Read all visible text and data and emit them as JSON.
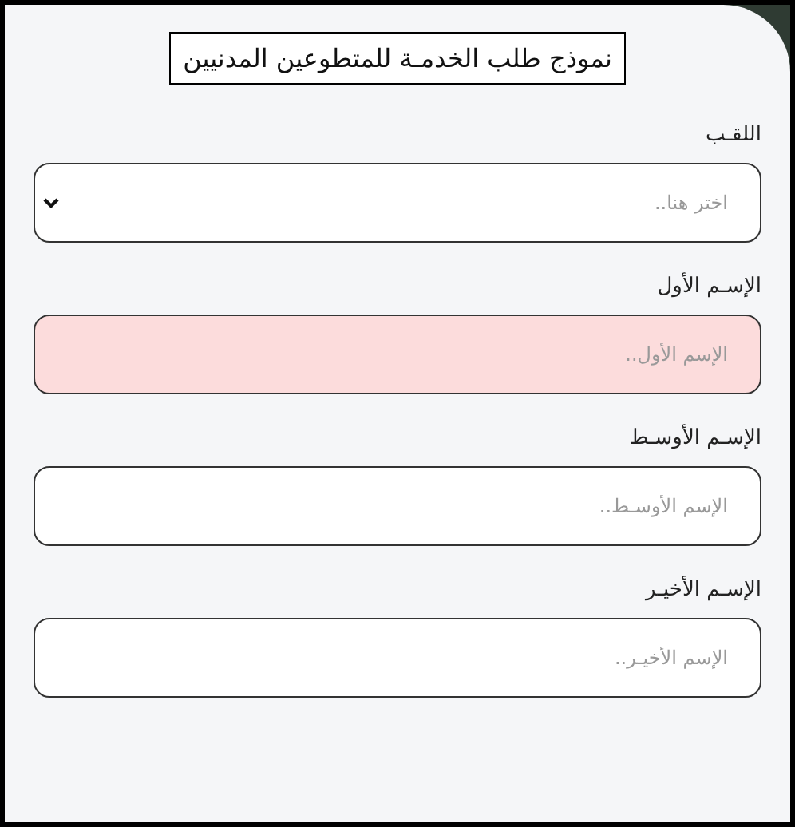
{
  "form": {
    "title": "نموذج طلب الخدمـة للمتطوعين المدنيين",
    "fields": [
      {
        "kind": "select",
        "label": "اللقـب",
        "placeholder": "اختر هنا..",
        "invalid": false
      },
      {
        "kind": "text",
        "label": "الإسـم الأول",
        "placeholder": "الإسم الأول..",
        "invalid": true
      },
      {
        "kind": "text",
        "label": "الإسـم الأوسـط",
        "placeholder": "الإسم الأوسـط..",
        "invalid": false
      },
      {
        "kind": "text",
        "label": "الإسـم الأخيـر",
        "placeholder": "الإسم الأخيـر..",
        "invalid": false
      }
    ]
  }
}
